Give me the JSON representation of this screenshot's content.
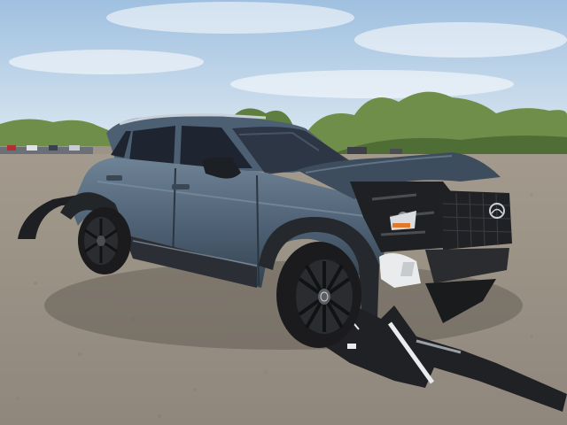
{
  "scene": {
    "subject": "damaged-suv",
    "colors": {
      "sky_top": "#9fc0e0",
      "sky_bottom": "#d9e6f0",
      "ground": "#9c9489",
      "ground_dark": "#7f786e",
      "trees": "#6f8e4a",
      "trees_dark": "#4f6e36",
      "car_body": "#4d6073",
      "car_body_dark": "#33414f",
      "car_body_light": "#6f8396",
      "glass": "#1f2530",
      "tire": "#1b1b1d",
      "rim": "#2a2c30",
      "debris_white": "#e9ebec",
      "plastic_black": "#202124"
    },
    "badge": {
      "brand_icon": "mazda-logo-icon"
    }
  }
}
